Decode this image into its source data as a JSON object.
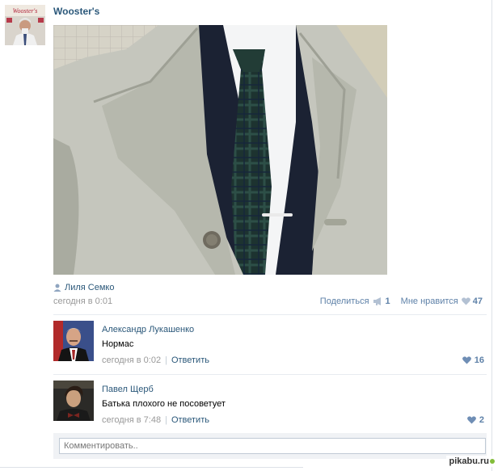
{
  "post": {
    "author": "Wooster's",
    "avatar_text": "Wooster's",
    "signer": "Лиля Семко",
    "date": "сегодня в 0:01",
    "share_label": "Поделиться",
    "share_count": "1",
    "like_label": "Мне нравится",
    "like_count": "47"
  },
  "comments": [
    {
      "author": "Александр Лукашенко",
      "text": "Нормас",
      "date": "сегодня в 0:02",
      "reply_label": "Ответить",
      "likes": "16"
    },
    {
      "author": "Павел Щерб",
      "text": "Батька плохого не посоветует",
      "date": "сегодня в 7:48",
      "reply_label": "Ответить",
      "likes": "2"
    }
  ],
  "reply_box": {
    "placeholder": "Комментировать.."
  },
  "watermark": {
    "text": "pikabu.ru"
  },
  "colors": {
    "link": "#2b587a",
    "muted": "#999999",
    "action": "#5e81a8",
    "separator": "#e7ebf0"
  },
  "icons": {
    "signer": "user-icon",
    "share": "megaphone-icon",
    "like": "heart-icon"
  }
}
